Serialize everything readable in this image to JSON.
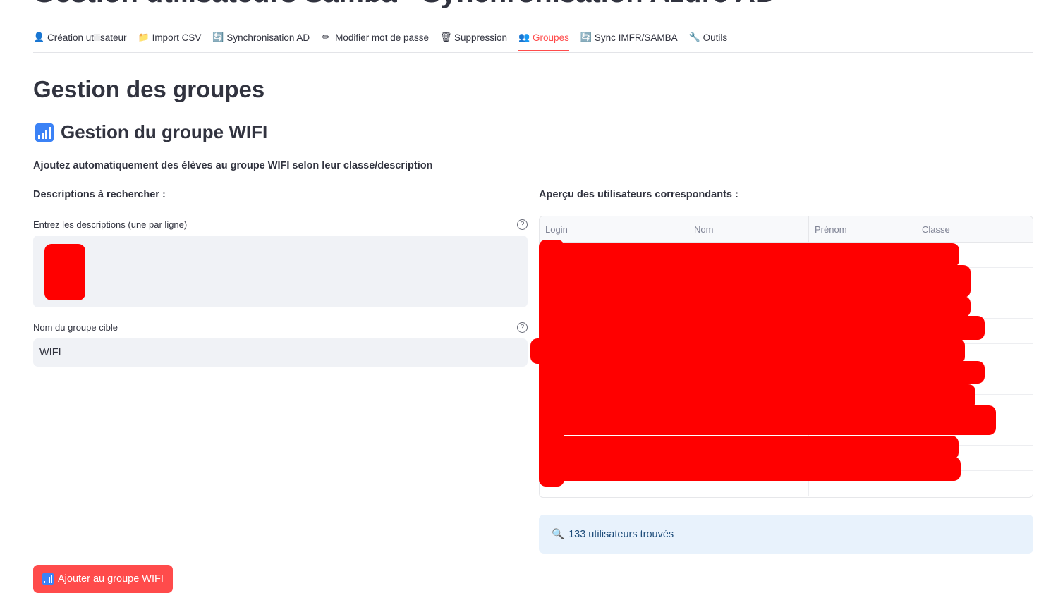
{
  "app": {
    "title": "Gestion utilisateurs Samba - Synchronisation Azure AD"
  },
  "tabs": [
    {
      "label": "Création utilisateur",
      "icon": "user-icon",
      "glyph": "👤",
      "active": false
    },
    {
      "label": "Import CSV",
      "icon": "folder-icon",
      "glyph": "📁",
      "active": false
    },
    {
      "label": "Synchronisation AD",
      "icon": "sync-icon",
      "glyph": "🔄",
      "active": false
    },
    {
      "label": "Modifier mot de passe",
      "icon": "pencil-icon",
      "glyph": "✏",
      "active": false
    },
    {
      "label": "Suppression",
      "icon": "trash-icon",
      "glyph": "🗑",
      "active": false
    },
    {
      "label": "Groupes",
      "icon": "users-icon",
      "glyph": "👥",
      "active": true
    },
    {
      "label": "Sync IMFR/SAMBA",
      "icon": "sync-icon",
      "glyph": "🔄",
      "active": false
    },
    {
      "label": "Outils",
      "icon": "wrench-icon",
      "glyph": "🔧",
      "active": false
    }
  ],
  "section": {
    "title": "Gestion des groupes",
    "subtitle": "Gestion du groupe WIFI",
    "intro": "Ajoutez automatiquement des élèves au groupe WIFI selon leur classe/description"
  },
  "left": {
    "title": "Descriptions à rechercher :",
    "descriptions_label": "Entrez les descriptions (une par ligne)",
    "group_label": "Nom du groupe cible",
    "group_value": "WIFI"
  },
  "right": {
    "title": "Aperçu des utilisateurs correspondants :",
    "columns": [
      "Login",
      "Nom",
      "Prénom",
      "Classe"
    ],
    "info": "133 utilisateurs trouvés"
  },
  "button": {
    "label": "Ajouter au groupe WIFI"
  },
  "colors": {
    "accent": "#ff4b4b",
    "info_bg": "#e8f2fc",
    "redaction": "#ff0000"
  }
}
